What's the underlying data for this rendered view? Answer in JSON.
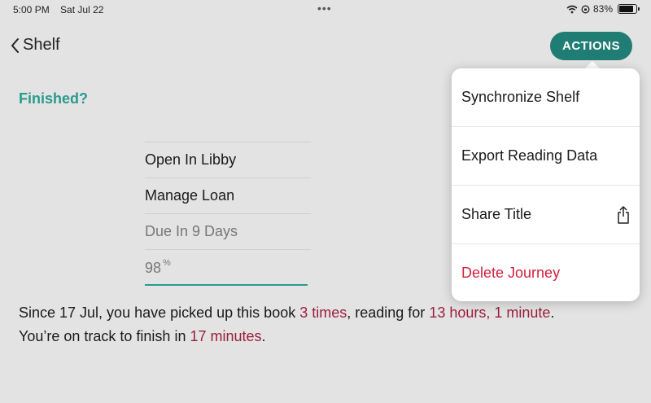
{
  "status_bar": {
    "time": "5:00 PM",
    "date": "Sat Jul 22",
    "battery": "83%",
    "battery_level": 0.83
  },
  "nav": {
    "back_label": "Shelf",
    "actions_label": "ACTIONS"
  },
  "finished_label": "Finished?",
  "menu": {
    "items": [
      "Open In Libby",
      "Manage Loan"
    ],
    "due": "Due In 9 Days",
    "progress_value": "98",
    "progress_unit": "%"
  },
  "summary": {
    "part1": "Since 17 Jul, you have picked up this book ",
    "times": "3 times",
    "part2": ", reading for ",
    "duration": "13 hours, 1 minute",
    "part3": ".",
    "line2_part1": "You’re on track to finish in ",
    "remaining": "17 minutes",
    "line2_part2": "."
  },
  "popover": {
    "sync": "Synchronize Shelf",
    "export": "Export Reading Data",
    "share": "Share Title",
    "delete": "Delete Journey"
  },
  "colors": {
    "accent": "#1f7d74",
    "teal_text": "#2a9b8d",
    "highlight": "#9b1e3e",
    "danger": "#d11f3c"
  }
}
